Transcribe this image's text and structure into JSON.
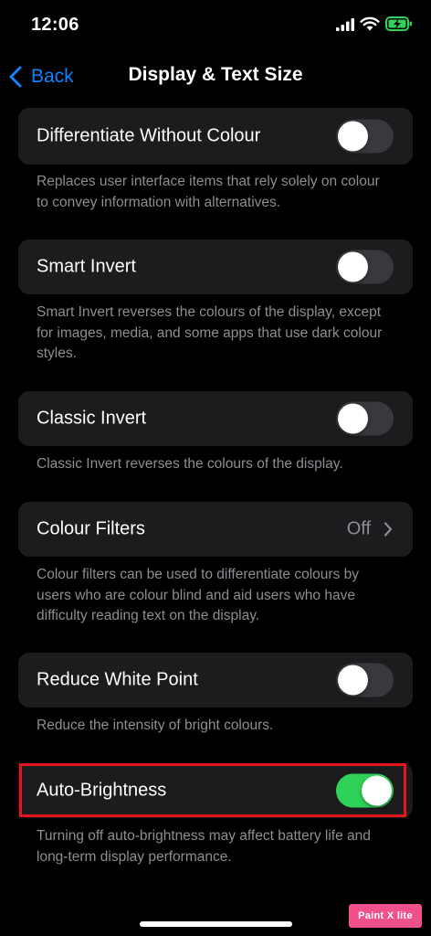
{
  "status_bar": {
    "time": "12:06",
    "icons": [
      "signal-icon",
      "wifi-icon",
      "battery-charging-icon"
    ]
  },
  "nav": {
    "back_label": "Back",
    "title": "Display & Text Size",
    "accent_color": "#0a84ff"
  },
  "settings": [
    {
      "label": "Differentiate Without Colour",
      "control": "toggle",
      "on": false,
      "footer": "Replaces user interface items that rely solely on colour to convey information with alternatives."
    },
    {
      "label": "Smart Invert",
      "control": "toggle",
      "on": false,
      "footer": "Smart Invert reverses the colours of the display, except for images, media, and some apps that use dark colour styles."
    },
    {
      "label": "Classic Invert",
      "control": "toggle",
      "on": false,
      "footer": "Classic Invert reverses the colours of the display."
    },
    {
      "label": "Colour Filters",
      "control": "disclosure",
      "value": "Off",
      "footer": "Colour filters can be used to differentiate colours by users who are colour blind and aid users who have difficulty reading text on the display."
    },
    {
      "label": "Reduce White Point",
      "control": "toggle",
      "on": false,
      "footer": "Reduce the intensity of bright colours."
    },
    {
      "label": "Auto-Brightness",
      "control": "toggle",
      "on": true,
      "highlighted": true,
      "footer": "Turning off auto-brightness may affect battery life and long-term display performance."
    }
  ],
  "colors": {
    "background": "#000000",
    "cell": "#1c1c1e",
    "toggle_on": "#30d158",
    "toggle_off": "#39393d",
    "secondary_text": "#8d8d93",
    "highlight": "#e4151f"
  },
  "watermark": {
    "text": "Paint X lite"
  }
}
